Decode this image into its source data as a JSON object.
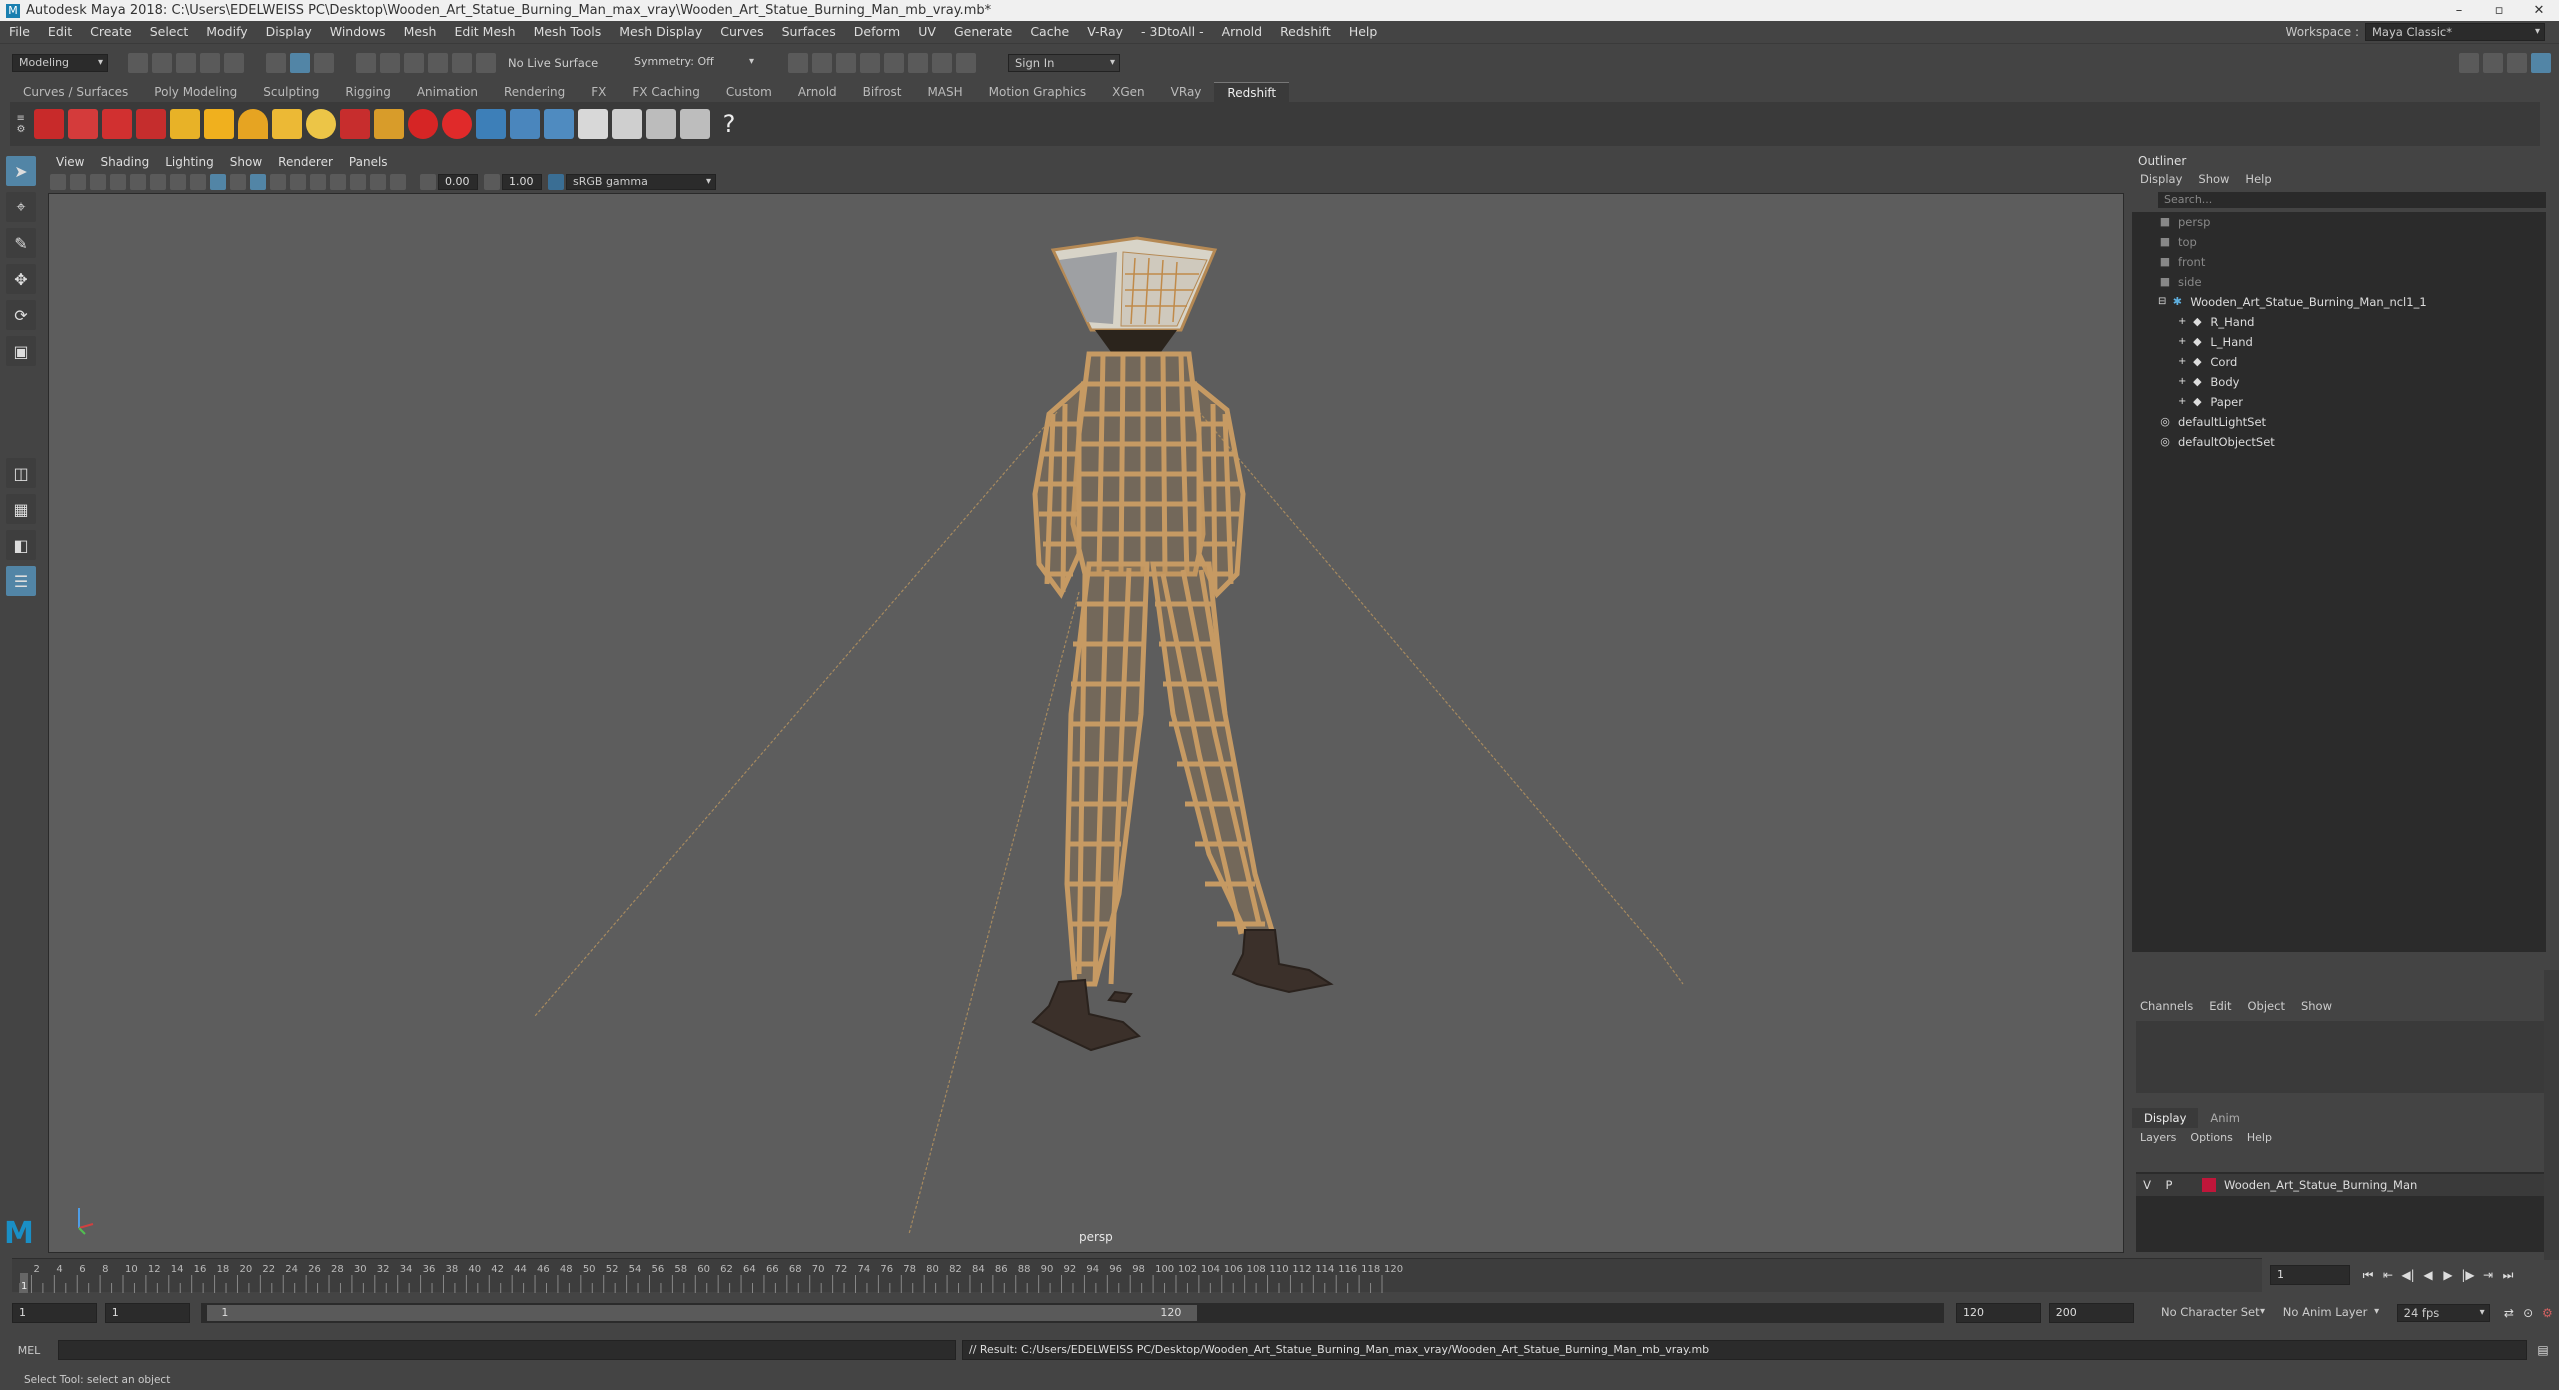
{
  "window": {
    "title": "Autodesk Maya 2018: C:\\Users\\EDELWEISS PC\\Desktop\\Wooden_Art_Statue_Burning_Man_max_vray\\Wooden_Art_Statue_Burning_Man_mb_vray.mb*",
    "minimize": "–",
    "maximize": "▫",
    "close": "✕"
  },
  "menubar": {
    "items": [
      "File",
      "Edit",
      "Create",
      "Select",
      "Modify",
      "Display",
      "Windows",
      "Mesh",
      "Edit Mesh",
      "Mesh Tools",
      "Mesh Display",
      "Curves",
      "Surfaces",
      "Deform",
      "UV",
      "Generate",
      "Cache",
      "V-Ray",
      "- 3DtoAll -",
      "Arnold",
      "Redshift",
      "Help"
    ],
    "workspace_label": "Workspace :",
    "workspace_value": "Maya Classic*"
  },
  "statusline": {
    "mode": "Modeling",
    "live_surface": "No Live Surface",
    "symmetry": "Symmetry: Off",
    "sign_in": "Sign In"
  },
  "shelf": {
    "tabs": [
      "Curves / Surfaces",
      "Poly Modeling",
      "Sculpting",
      "Rigging",
      "Animation",
      "Rendering",
      "FX",
      "FX Caching",
      "Custom",
      "Arnold",
      "Bifrost",
      "MASH",
      "Motion Graphics",
      "XGen",
      "VRay",
      "Redshift"
    ],
    "active_tab": "Redshift"
  },
  "viewport": {
    "menu": [
      "View",
      "Shading",
      "Lighting",
      "Show",
      "Renderer",
      "Panels"
    ],
    "exposure": "0.00",
    "gamma": "1.00",
    "color_space": "sRGB gamma",
    "camera": "persp"
  },
  "outliner": {
    "title": "Outliner",
    "menu": [
      "Display",
      "Show",
      "Help"
    ],
    "search_placeholder": "Search...",
    "items": [
      {
        "label": "persp",
        "depth": 0,
        "dim": true,
        "icon": "camera-icon"
      },
      {
        "label": "top",
        "depth": 0,
        "dim": true,
        "icon": "camera-icon"
      },
      {
        "label": "front",
        "depth": 0,
        "dim": true,
        "icon": "camera-icon"
      },
      {
        "label": "side",
        "depth": 0,
        "dim": true,
        "icon": "camera-icon"
      },
      {
        "label": "Wooden_Art_Statue_Burning_Man_ncl1_1",
        "depth": 0,
        "dim": false,
        "icon": "group-icon"
      },
      {
        "label": "R_Hand",
        "depth": 1,
        "dim": false,
        "icon": "mesh-icon"
      },
      {
        "label": "L_Hand",
        "depth": 1,
        "dim": false,
        "icon": "mesh-icon"
      },
      {
        "label": "Cord",
        "depth": 1,
        "dim": false,
        "icon": "mesh-icon"
      },
      {
        "label": "Body",
        "depth": 1,
        "dim": false,
        "icon": "mesh-icon"
      },
      {
        "label": "Paper",
        "depth": 1,
        "dim": false,
        "icon": "mesh-icon"
      },
      {
        "label": "defaultLightSet",
        "depth": 0,
        "dim": false,
        "icon": "set-icon"
      },
      {
        "label": "defaultObjectSet",
        "depth": 0,
        "dim": false,
        "icon": "set-icon"
      }
    ]
  },
  "channelbox": {
    "menu": [
      "Channels",
      "Edit",
      "Object",
      "Show"
    ]
  },
  "layers": {
    "tabs": [
      "Display",
      "Anim"
    ],
    "active_tab": "Display",
    "menu": [
      "Layers",
      "Options",
      "Help"
    ],
    "layer": {
      "v": "V",
      "p": "P",
      "name": "Wooden_Art_Statue_Burning_Man",
      "color": "#c0163a"
    }
  },
  "timeline": {
    "ticks": [
      "1",
      "2",
      "4",
      "6",
      "8",
      "10",
      "12",
      "14",
      "16",
      "18",
      "20",
      "22",
      "24",
      "26",
      "28",
      "30",
      "32",
      "34",
      "36",
      "38",
      "40",
      "42",
      "44",
      "46",
      "48",
      "50",
      "52",
      "54",
      "56",
      "58",
      "60",
      "62",
      "64",
      "66",
      "68",
      "70",
      "72",
      "74",
      "76",
      "78",
      "80",
      "82",
      "84",
      "86",
      "88",
      "90",
      "92",
      "94",
      "96",
      "98",
      "100",
      "102",
      "104",
      "106",
      "108",
      "110",
      "112",
      "114",
      "116",
      "118",
      "120"
    ],
    "current_frame": "1"
  },
  "range": {
    "start": "1",
    "playback_start": "1",
    "slider_start": "1",
    "slider_end": "120",
    "playback_end": "120",
    "end": "200",
    "character_set": "No Character Set",
    "anim_layer": "No Anim Layer",
    "fps": "24 fps"
  },
  "commandline": {
    "lang": "MEL",
    "result": "// Result: C:/Users/EDELWEISS PC/Desktop/Wooden_Art_Statue_Burning_Man_max_vray/Wooden_Art_Statue_Burning_Man_mb_vray.mb"
  },
  "helpline": "Select Tool: select an object",
  "colors": {
    "accent": "#5285a6",
    "wood": "#c69a63",
    "layer": "#c0163a"
  }
}
